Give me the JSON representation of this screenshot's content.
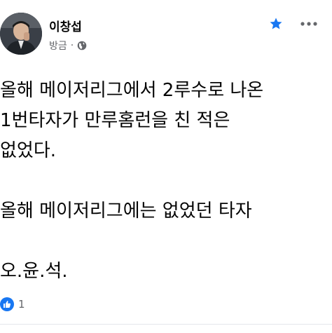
{
  "post": {
    "author": "이창섭",
    "time": "방금",
    "separator": "·",
    "audience_icon": "globe-icon",
    "lines": [
      "올해 메이저리그에서 2루수로 나온",
      "1번타자가 만루홈런을 친 적은",
      "없었다.",
      "",
      "올해 메이저리그에는 없었던 타자",
      "",
      "오.윤.석."
    ],
    "reactions": {
      "icon": "like-icon",
      "count": "1"
    }
  },
  "colors": {
    "accent": "#1877f2",
    "text": "#050505",
    "muted": "#65676b"
  }
}
